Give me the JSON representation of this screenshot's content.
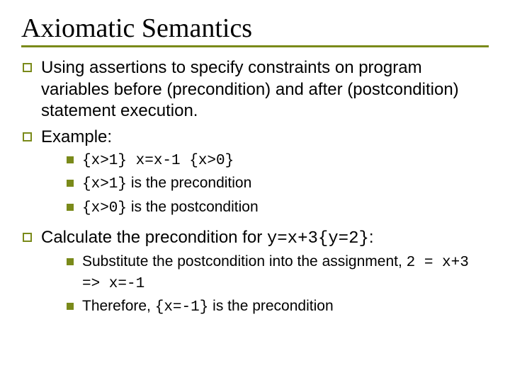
{
  "title": "Axiomatic Semantics",
  "bullets": {
    "b1": "Using assertions to specify constraints on program variables before (precondition) and after (postcondition) statement execution.",
    "b2": "Example:",
    "b2_1_code": "{x>1} x=x-1 {x>0}",
    "b2_2_code": "{x>1}",
    "b2_2_rest": " is the precondition",
    "b2_3_code": "{x>0}",
    "b2_3_rest": " is the postcondition",
    "b3_pre": "Calculate the precondition for ",
    "b3_code": "y=x+3{y=2}",
    "b3_post": ":",
    "b3_1a": "Substitute the postcondition into the assignment, ",
    "b3_1code": "2 = x+3 => x=-1",
    "b3_2a": "Therefore, ",
    "b3_2code": "{x=-1}",
    "b3_2b": " is the precondition"
  }
}
